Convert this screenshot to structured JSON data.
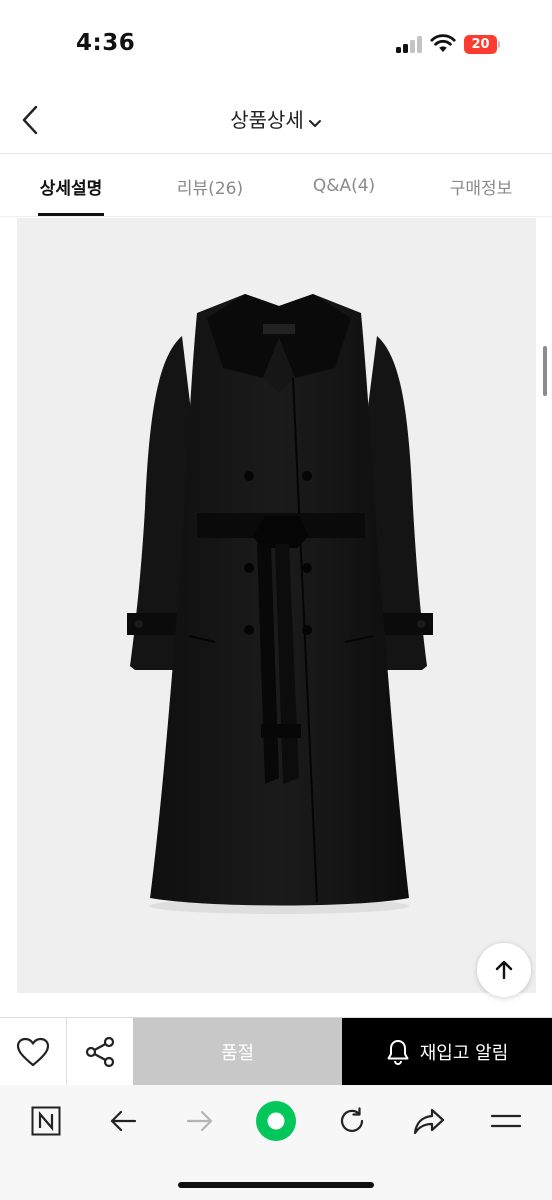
{
  "status_bar": {
    "time": "4:36",
    "battery": "20",
    "battery_color": "#ff3b30"
  },
  "header": {
    "title": "상품상세",
    "back_icon": "chevron-left-icon",
    "dropdown_icon": "chevron-down-icon"
  },
  "tabs": [
    {
      "label": "상세설명",
      "active": true
    },
    {
      "label": "리뷰(26)",
      "active": false
    },
    {
      "label": "Q&A(4)",
      "active": false
    },
    {
      "label": "구매정보",
      "active": false
    }
  ],
  "product_image": {
    "subject": "black double-breasted trench coat with belt",
    "background_color": "#efefef"
  },
  "actions": {
    "like_icon": "heart-icon",
    "share_icon": "share-icon",
    "soldout_label": "품절",
    "restock_label": "재입고 알림",
    "restock_icon": "bell-icon",
    "scroll_top_icon": "arrow-up-icon"
  },
  "browser_bar": {
    "icons": [
      "naver-icon",
      "back-arrow-icon",
      "forward-arrow-icon",
      "home-dot-icon",
      "refresh-icon",
      "share-arrow-icon",
      "menu-icon"
    ],
    "accent": "#03c75a"
  }
}
